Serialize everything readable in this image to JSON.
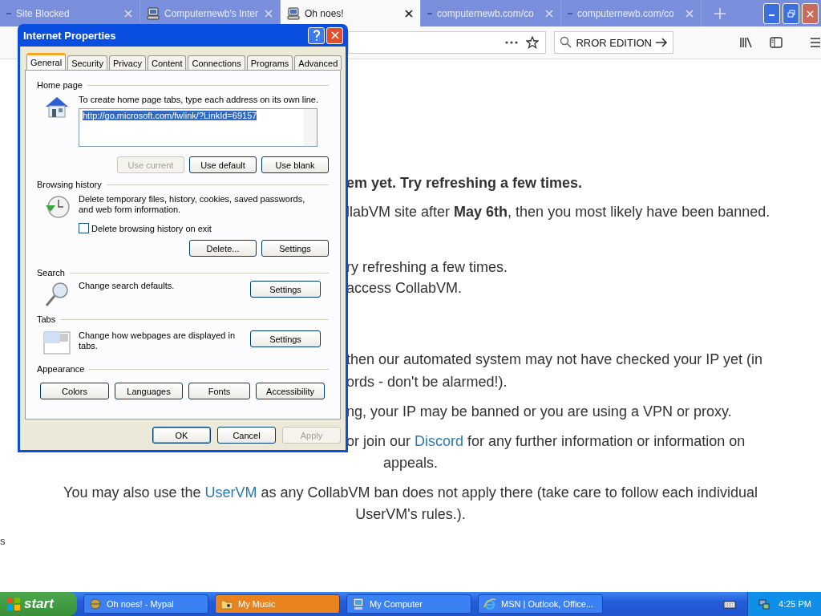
{
  "browser": {
    "tabs": [
      {
        "title": "Site Blocked",
        "icon": false,
        "selected": false
      },
      {
        "title": "Computernewb's Inter",
        "icon": true,
        "selected": false
      },
      {
        "title": "Oh noes!",
        "icon": true,
        "selected": true
      },
      {
        "title": "computernewb.com/co",
        "icon": false,
        "selected": false
      },
      {
        "title": "computernewb.com/co",
        "icon": false,
        "selected": false
      }
    ],
    "search_value": "RROR EDITION"
  },
  "page": {
    "lines": [
      {
        "kind": "fragment",
        "bold": true,
        "parts": [
          {
            "text": "em yet. Try refreshing a few times.",
            "link": false
          }
        ]
      },
      {
        "kind": "fragment",
        "bold": false,
        "parts": [
          {
            "text": "llabVM site after **May 6th**, then you most likely have been banned.",
            "link": false
          }
        ]
      },
      {
        "kind": "fragment",
        "bold": false,
        "parts": [
          {
            "text": "ry refreshing a few times.",
            "link": false
          }
        ]
      },
      {
        "kind": "fragment",
        "bold": false,
        "parts": [
          {
            "text": "access CollabVM.",
            "link": false
          }
        ]
      },
      {
        "kind": "fragment",
        "bold": false,
        "parts": [
          {
            "text": "then our automated system may not have checked your IP yet (in",
            "link": false
          }
        ]
      },
      {
        "kind": "fragment",
        "bold": false,
        "parts": [
          {
            "text": "ords - don't be alarmed!).",
            "link": false
          }
        ]
      },
      {
        "kind": "fragment",
        "bold": false,
        "parts": [
          {
            "text": "ng, your IP may be banned or you are using a VPN or proxy.",
            "link": false
          }
        ]
      },
      {
        "kind": "fragment",
        "bold": false,
        "parts": [
          {
            "text": "or join our ",
            "link": false
          },
          {
            "text": "Discord",
            "link": true
          },
          {
            "text": " for any further information or information on",
            "link": false
          }
        ]
      },
      {
        "kind": "centered",
        "bold": false,
        "parts": [
          {
            "text": "appeals.",
            "link": false
          }
        ]
      },
      {
        "kind": "centered",
        "bold": false,
        "parts": [
          {
            "text": "You may also use the ",
            "link": false
          },
          {
            "text": "UserVM",
            "link": true
          },
          {
            "text": " as any CollabVM ban does not apply there (take care to follow each individual",
            "link": false
          }
        ]
      },
      {
        "kind": "centered",
        "bold": false,
        "parts": [
          {
            "text": "UserVM's rules.).",
            "link": false
          }
        ]
      },
      {
        "kind": "edge",
        "bold": false,
        "parts": [
          {
            "text": "s",
            "link": false
          }
        ]
      }
    ]
  },
  "dialog": {
    "title": "Internet Properties",
    "tabs": [
      {
        "label": "General",
        "selected": true
      },
      {
        "label": "Security",
        "selected": false
      },
      {
        "label": "Privacy",
        "selected": false
      },
      {
        "label": "Content",
        "selected": false
      },
      {
        "label": "Connections",
        "selected": false
      },
      {
        "label": "Programs",
        "selected": false
      },
      {
        "label": "Advanced",
        "selected": false
      }
    ],
    "home_page": {
      "heading": "Home page",
      "text": "To create home page tabs, type each address on its own line.",
      "value": "http://go.microsoft.com/fwlink/?LinkId=69157",
      "buttons": [
        {
          "label": "Use current",
          "disabled": true
        },
        {
          "label": "Use default",
          "disabled": false
        },
        {
          "label": "Use blank",
          "disabled": false
        }
      ]
    },
    "browsing_history": {
      "heading": "Browsing history",
      "text": "Delete temporary files, history, cookies, saved passwords, and web form information.",
      "checkbox": {
        "label": "Delete browsing history on exit",
        "checked": false
      },
      "buttons": [
        {
          "label": "Delete...",
          "disabled": false
        },
        {
          "label": "Settings",
          "disabled": false
        }
      ]
    },
    "search": {
      "heading": "Search",
      "text": "Change search defaults.",
      "button": "Settings"
    },
    "tabs_section": {
      "heading": "Tabs",
      "text": "Change how webpages are displayed in tabs.",
      "button": "Settings"
    },
    "appearance": {
      "heading": "Appearance",
      "buttons": [
        "Colors",
        "Languages",
        "Fonts",
        "Accessibility"
      ]
    },
    "footer": [
      {
        "label": "OK",
        "disabled": false,
        "default": true
      },
      {
        "label": "Cancel",
        "disabled": false,
        "default": false
      },
      {
        "label": "Apply",
        "disabled": true,
        "default": false
      }
    ]
  },
  "taskbar": {
    "start": "start",
    "tasks": [
      {
        "label": "Oh noes! - Mypal",
        "highlighted": false
      },
      {
        "label": "My Music",
        "highlighted": true
      },
      {
        "label": "My Computer",
        "highlighted": false
      },
      {
        "label": "MSN | Outlook, Office...",
        "highlighted": false
      }
    ],
    "clock": "4:25 PM"
  }
}
